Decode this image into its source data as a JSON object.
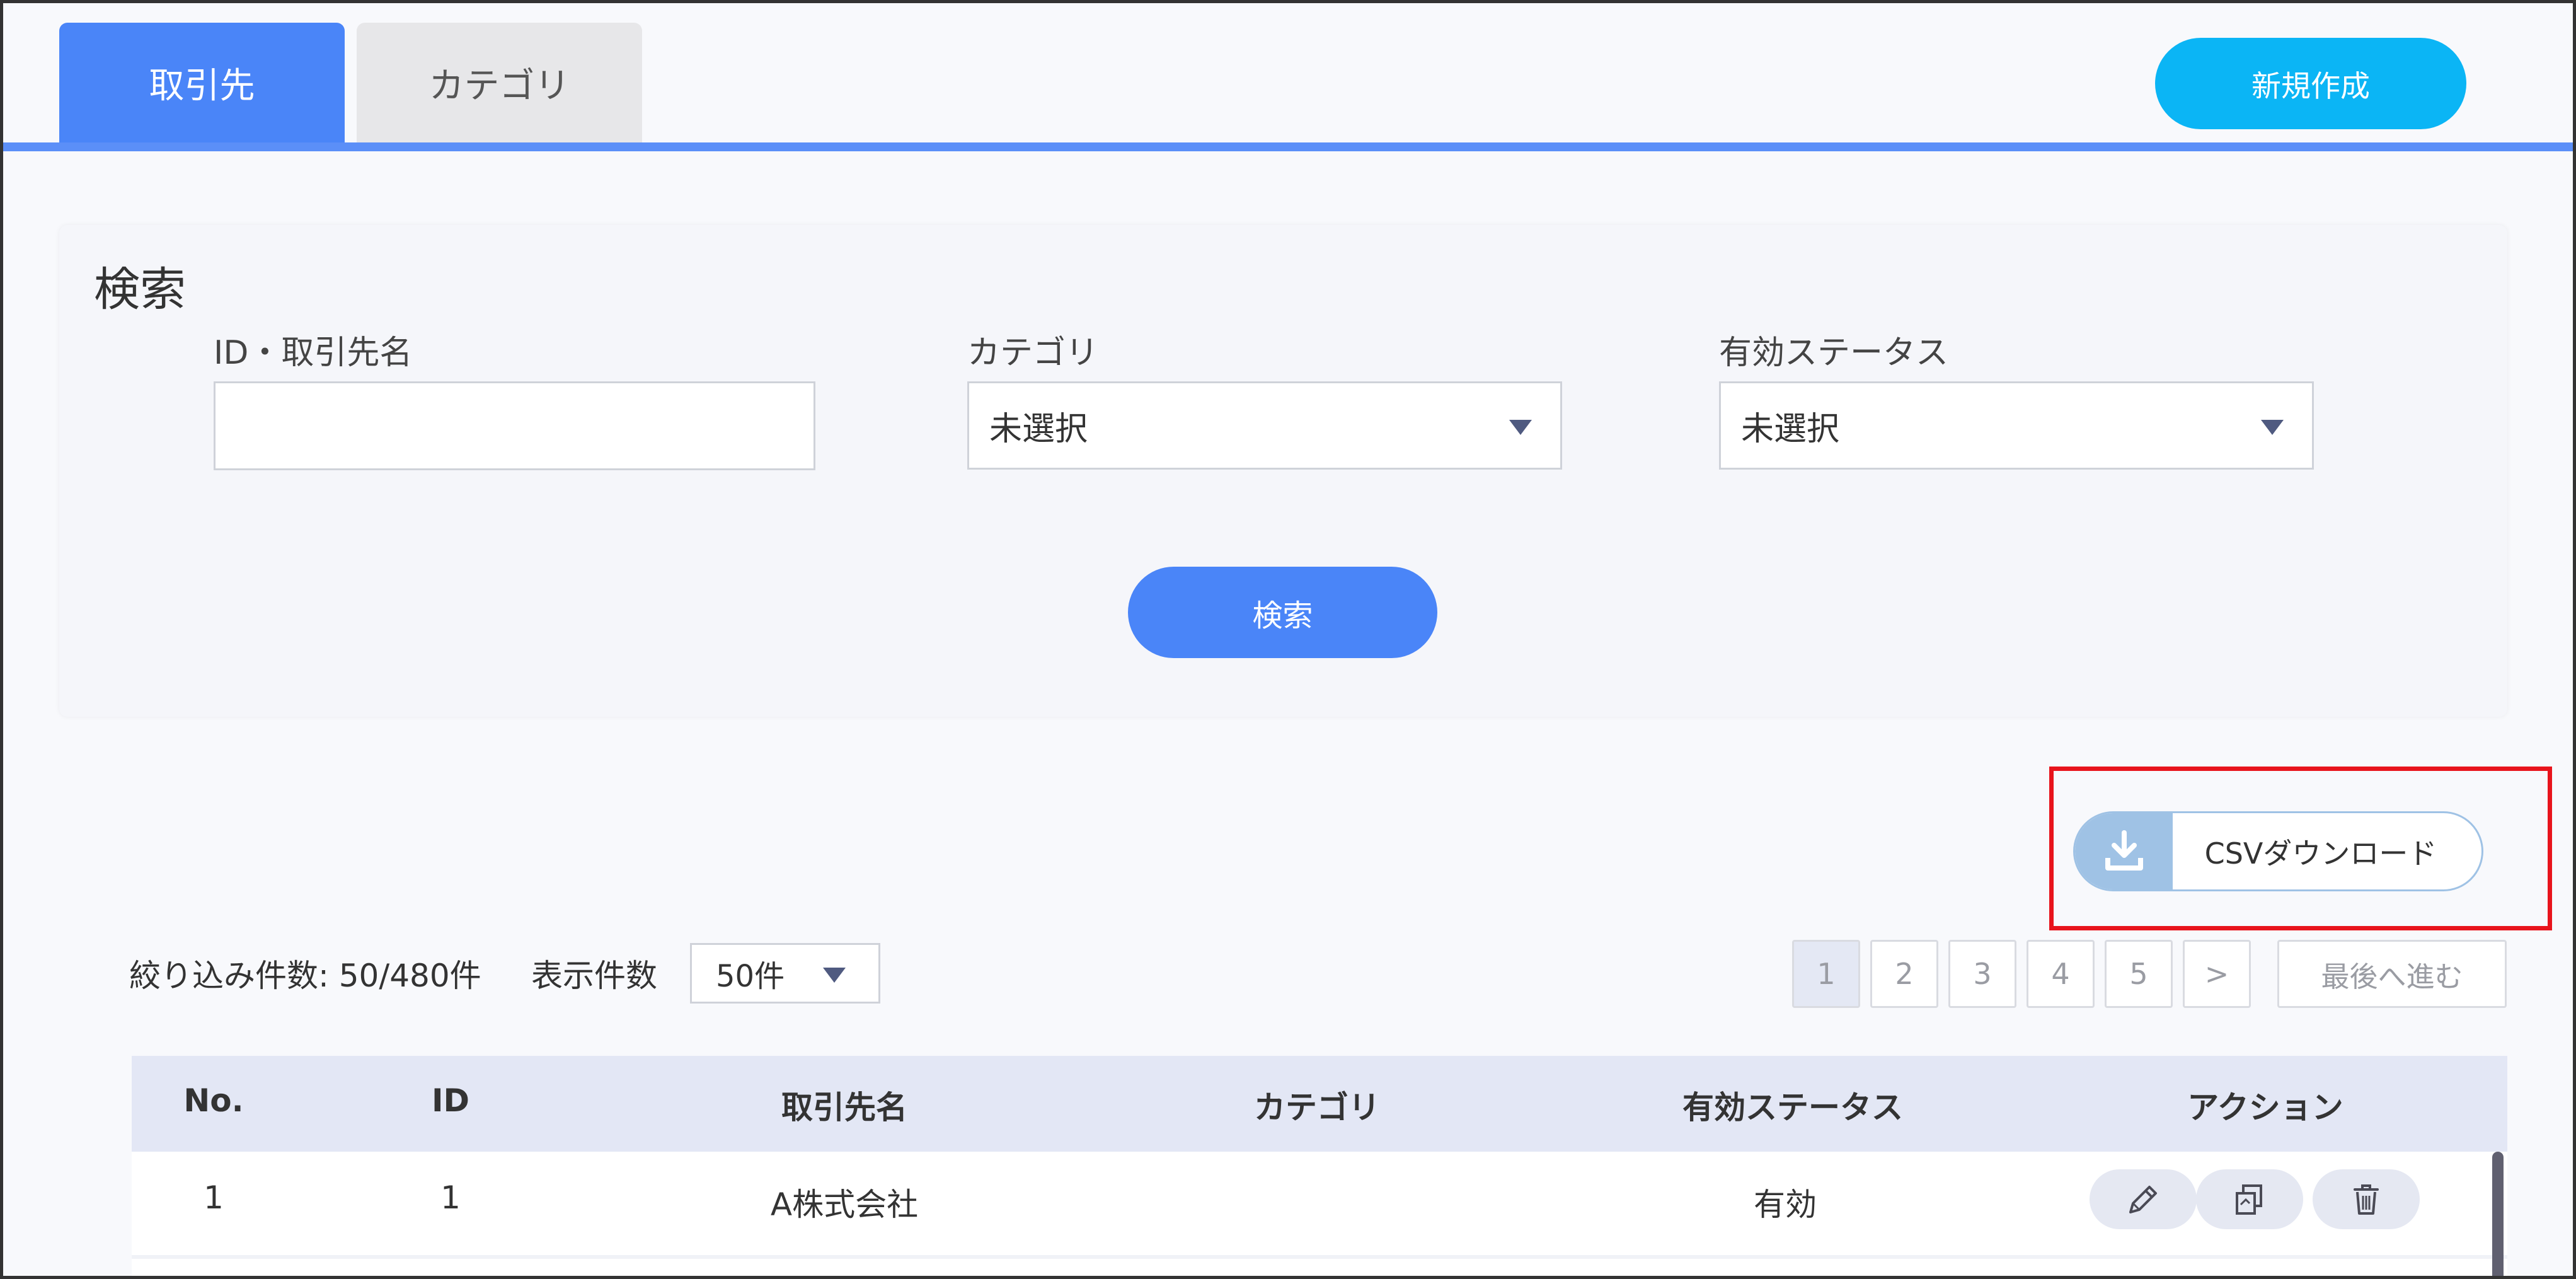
{
  "tabs": [
    {
      "label": "取引先",
      "active": true
    },
    {
      "label": "カテゴリ",
      "active": false
    }
  ],
  "header": {
    "new_button": "新規作成"
  },
  "search": {
    "title": "検索",
    "keyword_label": "ID・取引先名",
    "keyword_value": "",
    "category_label": "カテゴリ",
    "category_value": "未選択",
    "status_label": "有効ステータス",
    "status_value": "未選択",
    "search_button": "検索"
  },
  "csv": {
    "label": "CSVダウンロード",
    "icon": "download-icon"
  },
  "results": {
    "count_text": "絞り込み件数: 50/480件",
    "per_page_label": "表示件数",
    "per_page_value": "50件"
  },
  "pagination": {
    "pages": [
      "1",
      "2",
      "3",
      "4",
      "5"
    ],
    "current": "1",
    "next": ">",
    "last": "最後へ進む"
  },
  "table": {
    "columns": [
      "No.",
      "ID",
      "取引先名",
      "カテゴリ",
      "有効ステータス",
      "アクション"
    ],
    "rows": [
      {
        "no": "1",
        "id": "1",
        "name": "A株式会社",
        "category": "",
        "status": "有効"
      }
    ],
    "actions": [
      "pencil-icon",
      "copy-icon",
      "trash-icon"
    ]
  },
  "colors": {
    "primary": "#4a85f8",
    "new_button": "#0bb5f5",
    "highlight": "#e8141c",
    "csv_accent": "#9fc2e5"
  }
}
